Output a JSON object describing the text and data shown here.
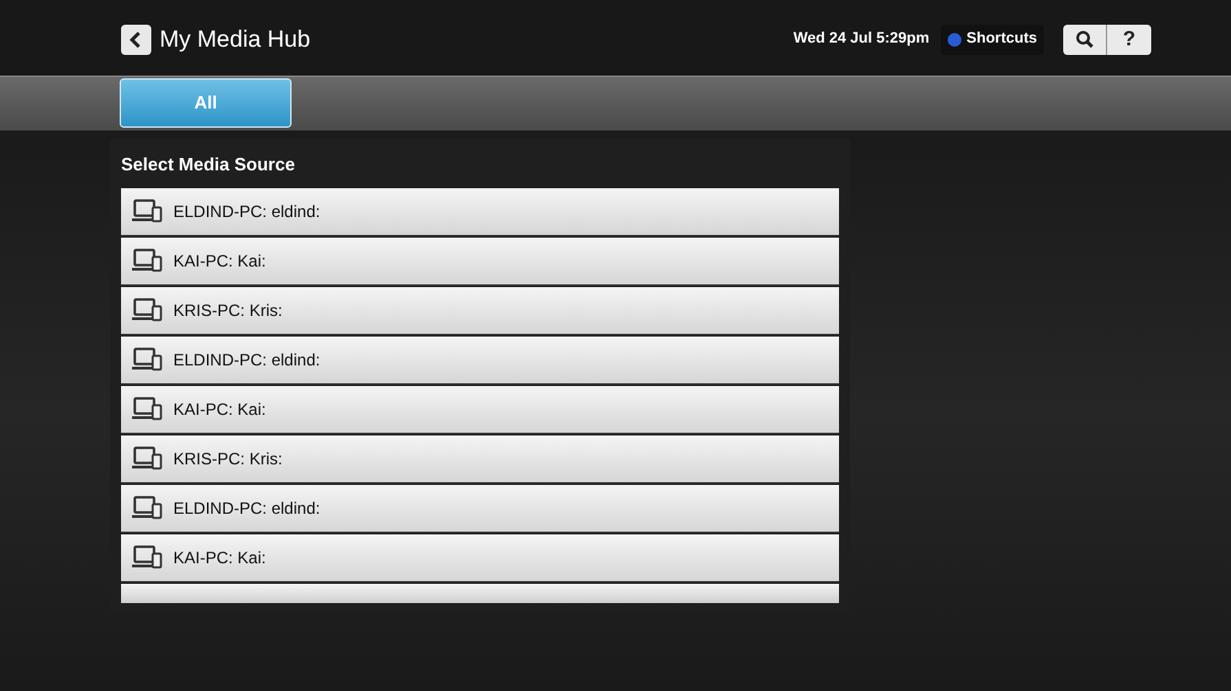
{
  "header": {
    "title": "My Media Hub",
    "datetime": "Wed 24 Jul 5:29pm",
    "shortcuts": "Shortcuts",
    "help": "?"
  },
  "tabs": [
    {
      "label": "All",
      "selected": true
    }
  ],
  "panel": {
    "heading": "Select Media Source",
    "items": [
      {
        "label": "ELDIND-PC: eldind:"
      },
      {
        "label": "KAI-PC: Kai:"
      },
      {
        "label": "KRIS-PC: Kris:"
      },
      {
        "label": "ELDIND-PC: eldind:"
      },
      {
        "label": "KAI-PC: Kai:"
      },
      {
        "label": "KRIS-PC: Kris:"
      },
      {
        "label": "ELDIND-PC: eldind:"
      },
      {
        "label": "KAI-PC: Kai:"
      }
    ],
    "cut_off_row": true
  }
}
